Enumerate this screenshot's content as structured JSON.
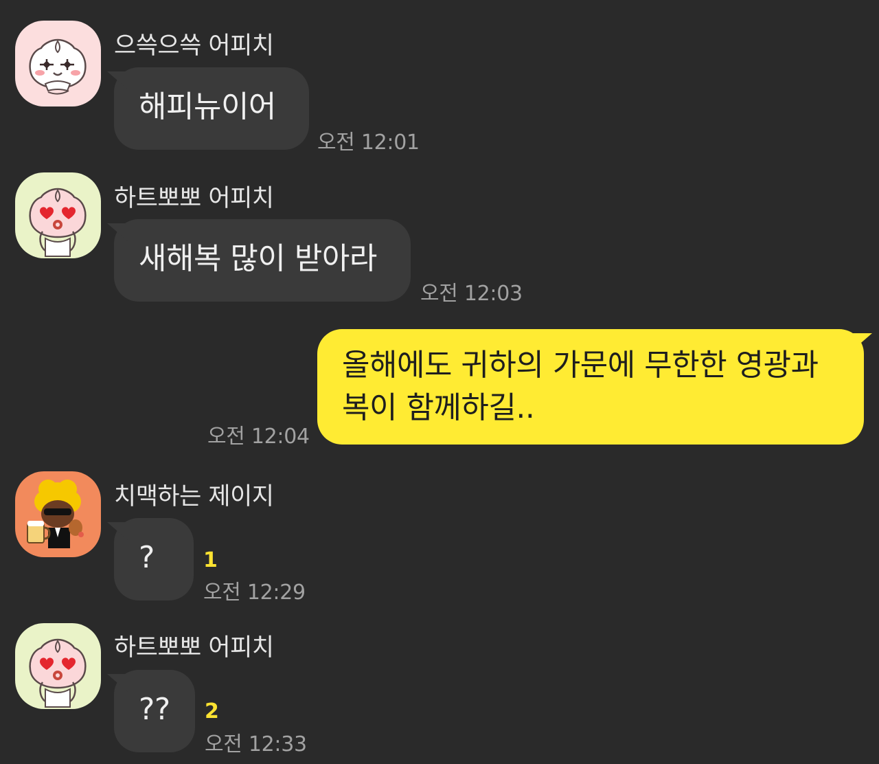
{
  "messages": [
    {
      "sender": "으쓱으쓱 어피치",
      "text": "해피뉴이어",
      "time": "오전 12:01",
      "avatar": "apeach-shrug-icon"
    },
    {
      "sender": "하트뽀뽀 어피치",
      "text": "새해복 많이 받아라",
      "time": "오전 12:03",
      "avatar": "apeach-heart-kiss-icon"
    },
    {
      "text": "올해에도 귀하의 가문에 무한한 영광과 복이 함께하길..",
      "time": "오전 12:04"
    },
    {
      "sender": "치맥하는 제이지",
      "text": "?",
      "unread": "1",
      "time": "오전 12:29",
      "avatar": "jayg-chimaek-icon"
    },
    {
      "sender": "하트뽀뽀 어피치",
      "text": "??",
      "unread": "2",
      "time": "오전 12:33",
      "avatar": "apeach-heart-kiss-icon"
    }
  ],
  "colors": {
    "background": "#2a2a2a",
    "other_bubble": "#3a3a3a",
    "my_bubble": "#ffeb33",
    "unread_count": "#fbe231"
  }
}
